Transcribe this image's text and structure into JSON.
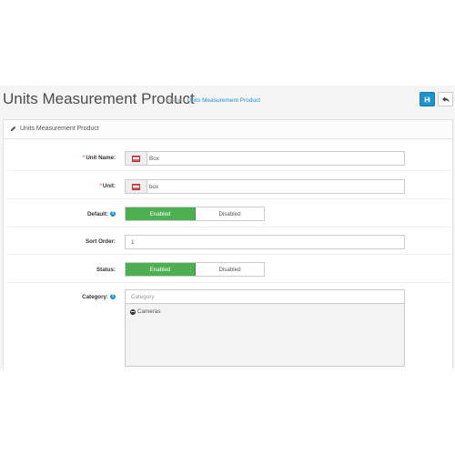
{
  "header": {
    "title": "Units Measurement Product",
    "breadcrumb": {
      "home": "Home",
      "separator": "›",
      "current": "Units Measurement Product"
    }
  },
  "panel": {
    "title": "Units Measurement Product"
  },
  "form": {
    "unit_name": {
      "label": "Unit Name:",
      "required": "*",
      "value": "Box"
    },
    "unit": {
      "label": "Unit:",
      "required": "*",
      "value": "box"
    },
    "default": {
      "label": "Default:",
      "on_label": "Enabled",
      "off_label": "Disabled",
      "selected": "Enabled"
    },
    "sort_order": {
      "label": "Sort Order:",
      "value": "1"
    },
    "status": {
      "label": "Status:",
      "on_label": "Enabled",
      "off_label": "Disabled",
      "selected": "Enabled"
    },
    "category": {
      "label": "Category:",
      "placeholder": "Category",
      "items": [
        "Cameras"
      ]
    }
  },
  "colors": {
    "primary": "#1e91cf",
    "enabled": "#4caf50",
    "required": "#f56b6b"
  },
  "icons": {
    "save": "save-icon",
    "back": "reply-icon",
    "panel": "pencil-icon",
    "help": "question-circle-icon",
    "remove": "minus-circle-icon",
    "flag": "flag-icon"
  }
}
